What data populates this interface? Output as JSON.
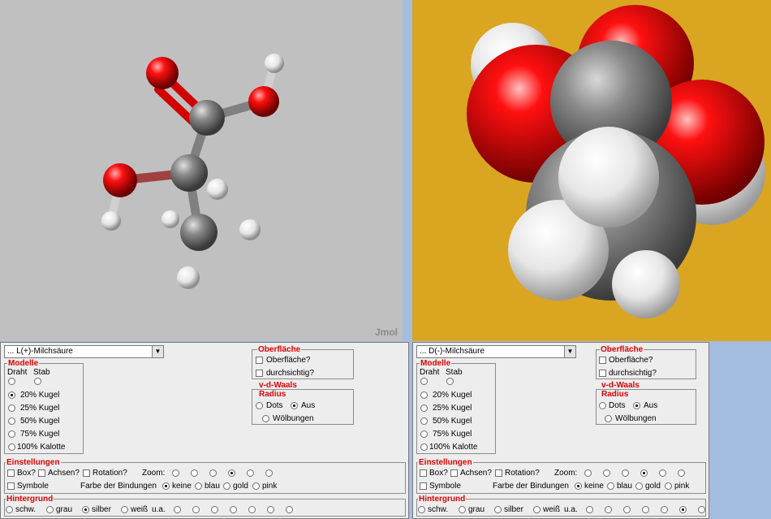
{
  "viewers": {
    "left": {
      "background": "#c0c0c0",
      "logo": "Jmol"
    },
    "right": {
      "background": "#daa520"
    }
  },
  "panels": [
    {
      "selected_model": "... L(+)-Milchsäure",
      "modelle": {
        "legend": "Modelle",
        "col_draht": "Draht",
        "col_stab": "Stab",
        "options": [
          "20%  Kugel",
          "25%  Kugel",
          "50%  Kugel",
          "75%  Kugel",
          "100% Kalotte"
        ],
        "selected_index": 0
      },
      "oberflaeche": {
        "legend": "Oberfläche",
        "opt1": "Oberfläche?",
        "opt2": "durchsichtig?"
      },
      "vdw": {
        "legend1": "v-d-Waals",
        "legend2": "Radius",
        "dots": "Dots",
        "aus": "Aus",
        "woelbungen": "Wölbungen",
        "selected": "aus"
      },
      "einstellungen": {
        "legend": "Einstellungen",
        "box": "Box?",
        "achsen": "Achsen?",
        "rotation": "Rotation?",
        "zoom": "Zoom:",
        "zoom_selected": 3,
        "symbole": "Symbole",
        "farbe": "Farbe der Bindungen",
        "bond_colors": [
          "keine",
          "blau",
          "gold",
          "pink"
        ],
        "bond_selected": 0
      },
      "hintergrund": {
        "legend": "Hintergrund",
        "colors": [
          "schw.",
          "grau",
          "silber",
          "weiß",
          "u.a."
        ],
        "selected": "silber",
        "extra_selected": -1
      }
    },
    {
      "selected_model": "... D(-)-Milchsäure",
      "modelle": {
        "legend": "Modelle",
        "col_draht": "Draht",
        "col_stab": "Stab",
        "options": [
          "20%  Kugel",
          "25%  Kugel",
          "50%  Kugel",
          "75%  Kugel",
          "100% Kalotte"
        ],
        "selected_index": -1
      },
      "oberflaeche": {
        "legend": "Oberfläche",
        "opt1": "Oberfläche?",
        "opt2": "durchsichtig?"
      },
      "vdw": {
        "legend1": "v-d-Waals",
        "legend2": "Radius",
        "dots": "Dots",
        "aus": "Aus",
        "woelbungen": "Wölbungen",
        "selected": "aus"
      },
      "einstellungen": {
        "legend": "Einstellungen",
        "box": "Box?",
        "achsen": "Achsen?",
        "rotation": "Rotation?",
        "zoom": "Zoom:",
        "zoom_selected": 3,
        "symbole": "Symbole",
        "farbe": "Farbe der Bindungen",
        "bond_colors": [
          "keine",
          "blau",
          "gold",
          "pink"
        ],
        "bond_selected": 0
      },
      "hintergrund": {
        "legend": "Hintergrund",
        "colors": [
          "schw.",
          "grau",
          "silber",
          "weiß",
          "u.a."
        ],
        "selected": "none",
        "extra_selected": 6
      }
    }
  ]
}
